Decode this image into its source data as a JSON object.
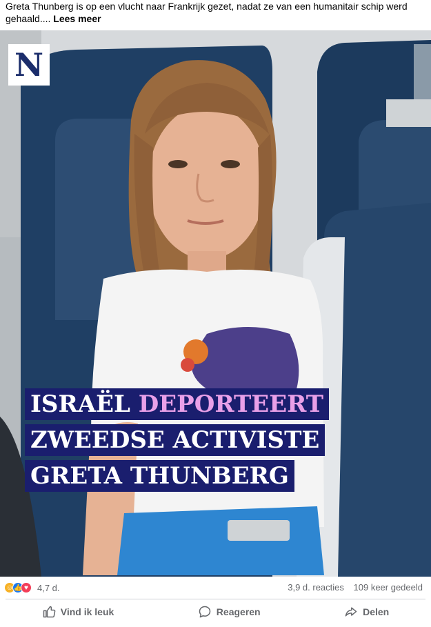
{
  "post": {
    "caption": "Greta Thunberg is op een vlucht naar Frankrijk gezet, nadat ze van een humanitair schip werd gehaald....",
    "see_more": "Lees meer"
  },
  "media": {
    "logo_letter": "N",
    "overlay": {
      "line1_plain": "ISRAËL ",
      "line1_highlight": "DEPORTEERT",
      "line2": "ZWEEDSE ACTIVISTE",
      "line3": "GRETA THUNBERG"
    }
  },
  "stats": {
    "reaction_icons": [
      "haha-icon",
      "like-icon",
      "love-icon"
    ],
    "reaction_count": "4,7 d.",
    "comments": "3,9 d. reacties",
    "shares": "109 keer gedeeld"
  },
  "actions": {
    "like": "Vind ik leuk",
    "comment": "Reageren",
    "share": "Delen"
  },
  "colors": {
    "overlay_bg": "#1a1e6e",
    "overlay_highlight": "#e9a0e8",
    "logo_text": "#1b2d6b",
    "like_blue": "#1877f2",
    "love_red": "#f33e58",
    "haha_yellow": "#f7b125"
  }
}
